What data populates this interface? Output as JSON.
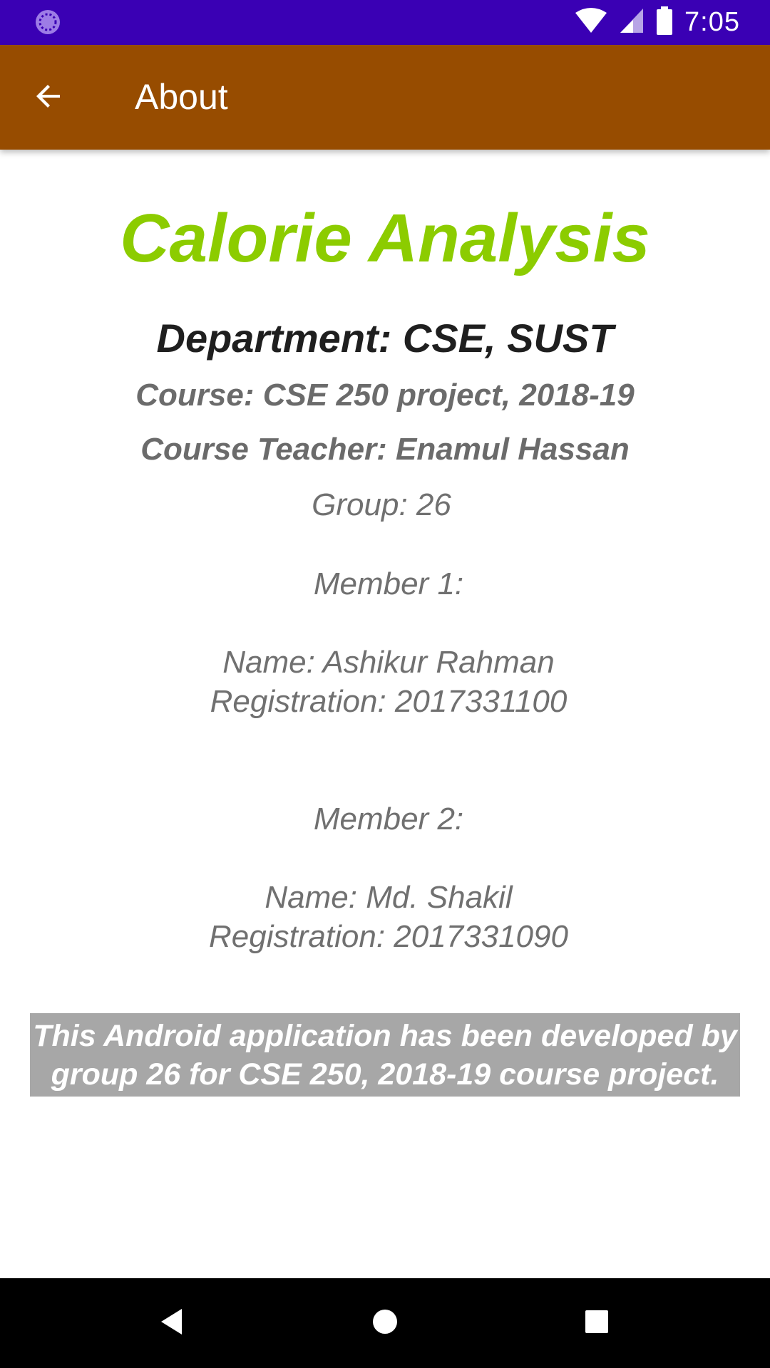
{
  "status_bar": {
    "time": "7:05",
    "left_icon": "loading-spinner-icon",
    "icons": [
      "wifi-icon",
      "signal-icon",
      "battery-icon"
    ],
    "background": "#3a00b4"
  },
  "app_bar": {
    "title": "About",
    "back_icon": "arrow-back-icon",
    "background": "#974c00"
  },
  "content": {
    "app_name": "Calorie Analysis",
    "app_name_color": "#8ccc00",
    "department": "Department: CSE, SUST",
    "course": "Course: CSE 250 project, 2018-19",
    "teacher": "Course Teacher: Enamul Hassan",
    "group": "Group: 26",
    "members": [
      {
        "heading": "Member 1:",
        "name": "Name: Ashikur Rahman",
        "registration": "Registration: 2017331100"
      },
      {
        "heading": "Member 2:",
        "name": "Name: Md. Shakil",
        "registration": "Registration: 2017331090"
      }
    ],
    "note_line1": "This Android application has been developed by",
    "note_line2": "group 26 for CSE 250, 2018-19 course project."
  },
  "nav_bar": {
    "buttons": [
      "back-triangle-icon",
      "home-circle-icon",
      "recents-square-icon"
    ]
  }
}
